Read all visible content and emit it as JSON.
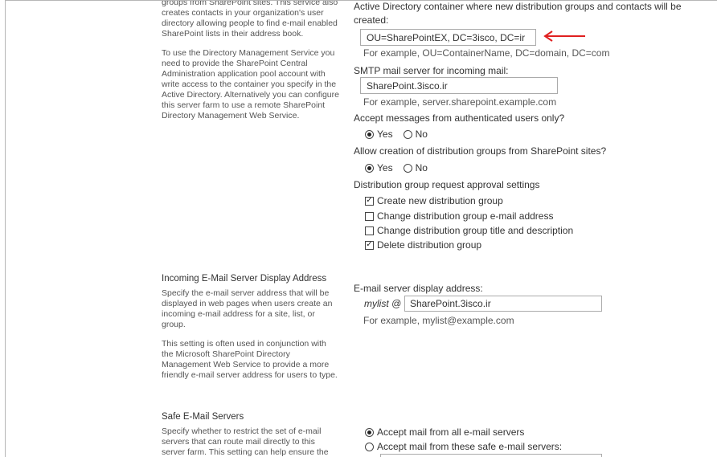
{
  "directory_section": {
    "description": [
      "groups from SharePoint sites. This service also creates contacts in your organization's user directory allowing people to find e-mail enabled SharePoint lists in their address book.",
      "To use the Directory Management Service you need to provide the SharePoint Central Administration application pool account with write access to the container you specify in the Active Directory. Alternatively you can configure this server farm to use a remote SharePoint Directory Management Web Service."
    ],
    "container_label_line1": "Active Directory container where new distribution groups and contacts will be",
    "container_label_line2": "created:",
    "container_value": "OU=SharePointEX, DC=3isco, DC=ir",
    "container_example": "For example, OU=ContainerName, DC=domain, DC=com",
    "smtp_label": "SMTP mail server for incoming mail:",
    "smtp_value": "SharePoint.3isco.ir",
    "smtp_example": "For example, server.sharepoint.example.com",
    "accept_auth_label": "Accept messages from authenticated users only?",
    "accept_auth_yes": "Yes",
    "accept_auth_no": "No",
    "accept_auth_selected": "Yes",
    "allow_creation_label": "Allow creation of distribution groups from SharePoint sites?",
    "allow_creation_yes": "Yes",
    "allow_creation_no": "No",
    "allow_creation_selected": "Yes",
    "approval_label": "Distribution group request approval settings",
    "approval_options": [
      {
        "label": "Create new distribution group",
        "checked": true
      },
      {
        "label": "Change distribution group e-mail address",
        "checked": false
      },
      {
        "label": "Change distribution group title and description",
        "checked": false
      },
      {
        "label": "Delete distribution group",
        "checked": true
      }
    ],
    "arrow_color": "#e02020"
  },
  "display_address_section": {
    "title": "Incoming E-Mail Server Display Address",
    "description": [
      "Specify the e-mail server address that will be displayed in web pages when users create an incoming e-mail address for a site, list, or group.",
      "This setting is often used in conjunction with the Microsoft SharePoint Directory Management Web Service to provide a more friendly e-mail server address for users to type."
    ],
    "field_label": "E-mail server display address:",
    "prefix": "mylist @",
    "value": "SharePoint.3isco.ir",
    "example": "For example, mylist@example.com"
  },
  "safe_servers_section": {
    "title": "Safe E-Mail Servers",
    "description": "Specify whether to restrict the set of e-mail servers that can route mail directly to this server farm. This setting can help ensure the",
    "option_all": "Accept mail from all e-mail servers",
    "option_safe": "Accept mail from these safe e-mail servers:",
    "selected": "all"
  }
}
